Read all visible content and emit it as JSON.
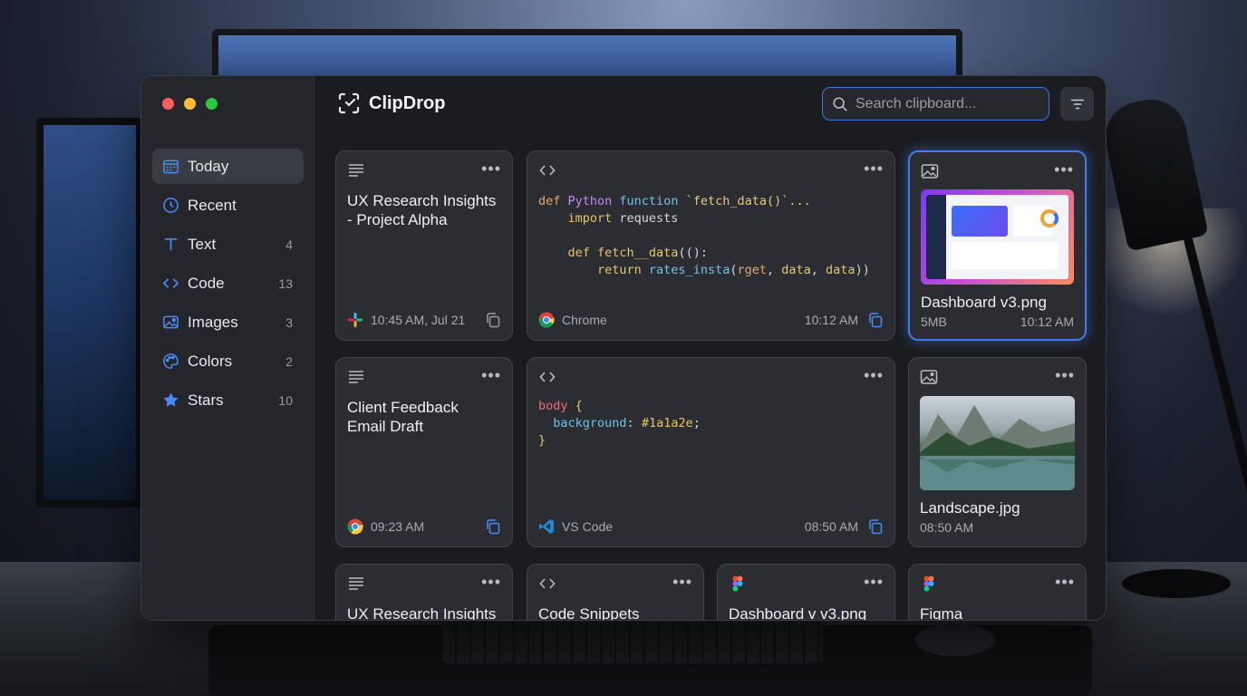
{
  "app": {
    "name": "ClipDrop"
  },
  "search": {
    "placeholder": "Search clipboard..."
  },
  "sidebar": {
    "items": [
      {
        "label": "Today",
        "count": ""
      },
      {
        "label": "Recent",
        "count": ""
      },
      {
        "label": "Text",
        "count": "4"
      },
      {
        "label": "Code",
        "count": "13"
      },
      {
        "label": "Images",
        "count": "3"
      },
      {
        "label": "Colors",
        "count": "2"
      },
      {
        "label": "Stars",
        "count": "10"
      }
    ]
  },
  "cards": {
    "c1": {
      "type_icon": "text-lines-icon",
      "title": "UX Research Insights - Project Alpha",
      "app": "slack-icon",
      "time": "10:45 AM, Jul 21"
    },
    "c2": {
      "type_icon": "code-brackets-icon",
      "app": "chrome-icon",
      "app_name": "Chrome",
      "time": "10:12 AM",
      "code": {
        "l1a": "def",
        "l1b": " Python ",
        "l1c": "function",
        "l1d": " `fetch_data()`...",
        "l2a": "    import",
        "l2b": " requests",
        "l4a": "    def",
        "l4b": " fetch__data",
        "l4c": "(():",
        "l5a": "        return",
        "l5b": " rates_insta",
        "l5c": "(",
        "l5d": "rget",
        "l5e": ", ",
        "l5f": "data",
        "l5g": ", ",
        "l5h": "data",
        "l5i": "))"
      }
    },
    "c3": {
      "type_icon": "image-icon",
      "title": "Dashboard v3.png",
      "size": "5MB",
      "time": "10:12 AM"
    },
    "c4": {
      "type_icon": "text-lines-icon",
      "title": "Client Feedback Email Draft",
      "app": "chrome-icon",
      "time": "09:23 AM"
    },
    "c5": {
      "type_icon": "code-brackets-icon",
      "app": "vscode-icon",
      "app_name": "VS Code",
      "time": "08:50 AM",
      "code": {
        "sel": "body",
        "open": " {",
        "prop": "  background",
        "colon": ": ",
        "val": "#1a1a2e",
        "semi": ";",
        "close": "}"
      }
    },
    "c6": {
      "type_icon": "image-icon",
      "title": "Landscape.jpg",
      "time": "08:50 AM"
    },
    "c7": {
      "type_icon": "text-lines-icon",
      "title": "UX Research Insights -"
    },
    "c8": {
      "type_icon": "code-brackets-icon",
      "title": "Code Snippets"
    },
    "c9": {
      "type_icon": "figma-icon",
      "title": "Dashboard v v3.png"
    },
    "c10": {
      "type_icon": "figma-icon",
      "title": "Figma"
    }
  },
  "menu_glyph": "•••",
  "colors": {
    "accent": "#3f7cf0",
    "window_bg": "#1b1c20",
    "card_bg": "#2b2d33"
  }
}
